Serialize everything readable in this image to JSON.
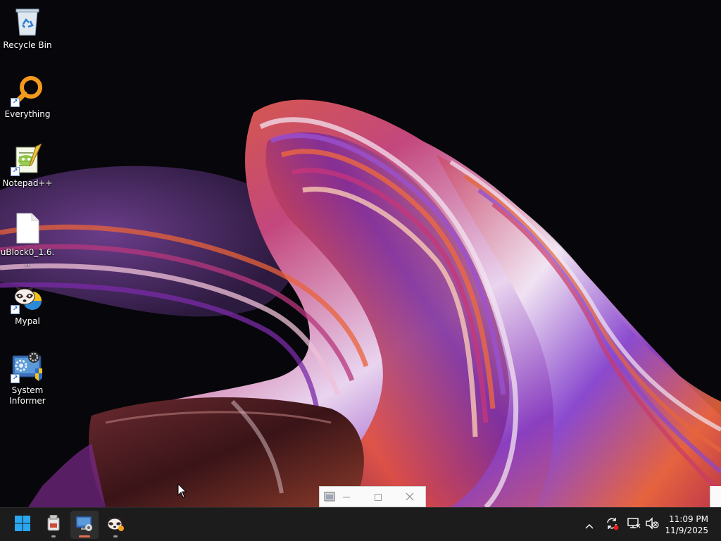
{
  "desktop": {
    "icons": [
      {
        "label": "Recycle Bin",
        "icon": "recycle-bin-icon",
        "shortcut": false
      },
      {
        "label": "Everything",
        "icon": "everything-search-icon",
        "shortcut": true
      },
      {
        "label": "Notepad++",
        "icon": "notepad-plus-plus-icon",
        "shortcut": true
      },
      {
        "label": "uBlock0_1.6...",
        "icon": "file-icon",
        "shortcut": false
      },
      {
        "label": "Mypal",
        "icon": "mypal-browser-icon",
        "shortcut": true
      },
      {
        "label": "System Informer",
        "icon": "system-informer-icon",
        "shortcut": true
      }
    ]
  },
  "taskbar": {
    "start": {
      "icon": "windows-start-icon"
    },
    "apps": [
      {
        "icon": "usb-drive-app-icon",
        "state": "open"
      },
      {
        "icon": "system-informer-app-icon",
        "state": "focused"
      },
      {
        "icon": "mypal-app-icon",
        "state": "open"
      }
    ],
    "tray": [
      {
        "icon": "chevron-up-icon"
      },
      {
        "icon": "sync-alert-icon"
      },
      {
        "icon": "network-icon"
      },
      {
        "icon": "volume-muted-icon"
      }
    ],
    "clock": {
      "time": "11:09 PM",
      "date": "11/9/2025"
    }
  },
  "mini_window": {
    "icon": "app-window-icon",
    "controls": [
      "minimize-icon",
      "maximize-icon",
      "close-icon"
    ]
  },
  "colors": {
    "taskbar_bg": "#1c1c1c",
    "focused_indicator": "#e3704f",
    "wallpaper_bg": "#07060a"
  }
}
